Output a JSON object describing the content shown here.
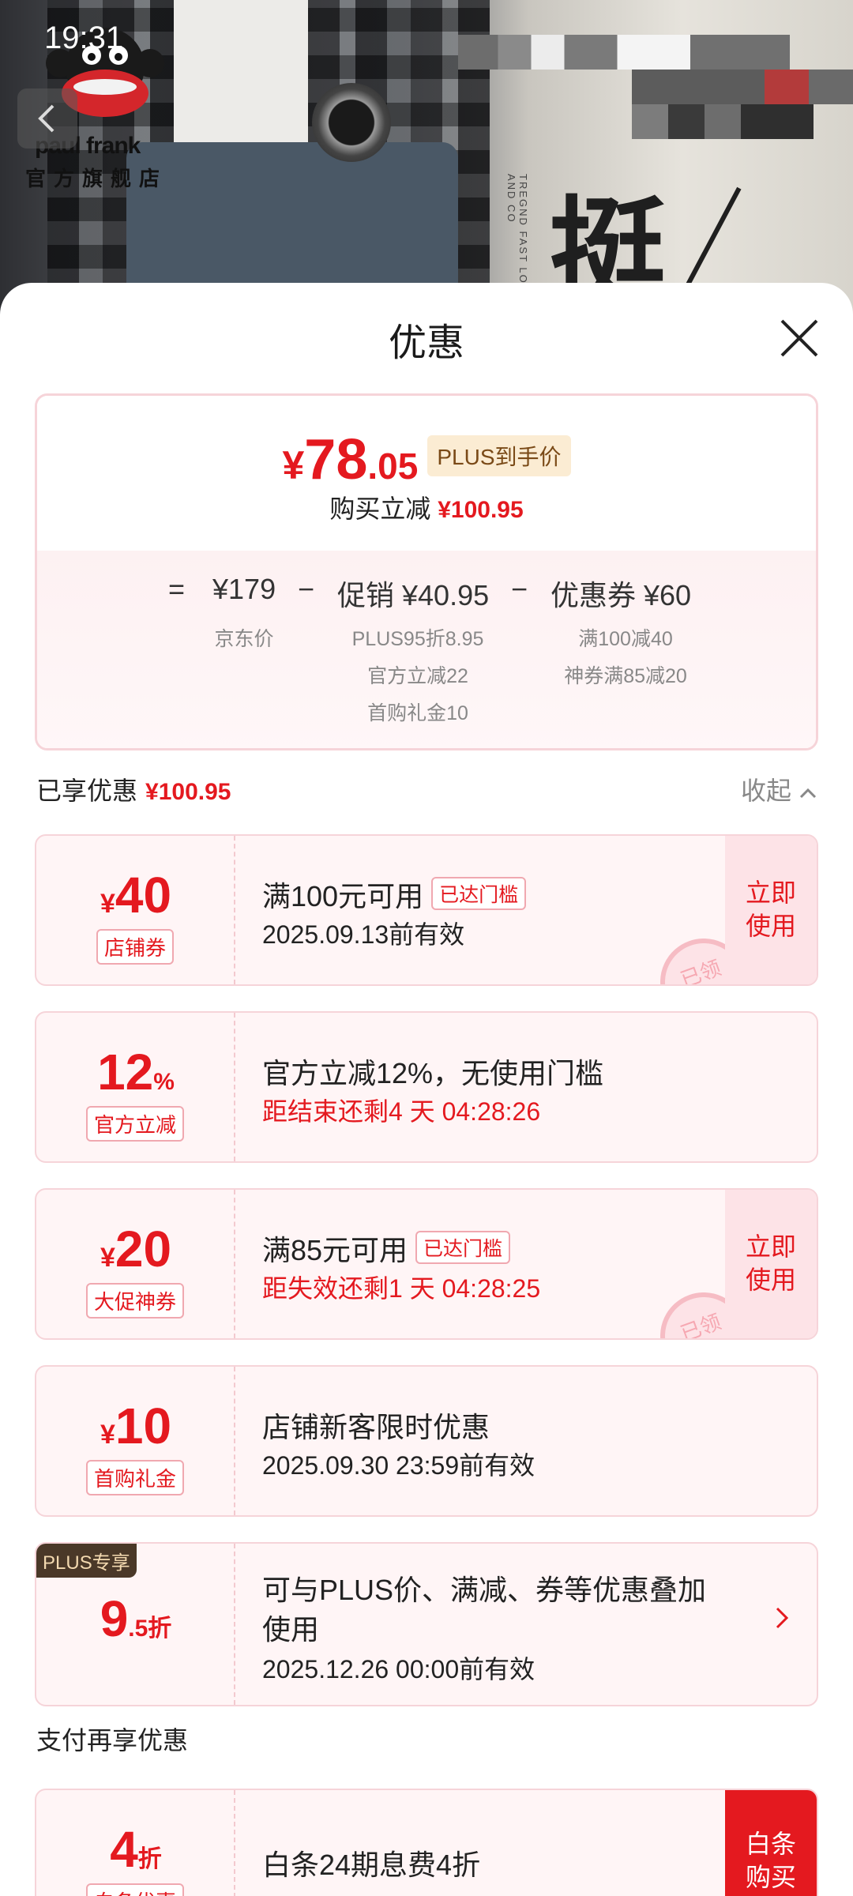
{
  "status_bar": {
    "time": "19:31"
  },
  "banner": {
    "brand_name": "paul frank",
    "brand_sub": "官方旗舰店",
    "big_char": "挺",
    "vertical_text": "TREGND FAST LOOSE AND CO"
  },
  "sheet": {
    "title": "优惠"
  },
  "summary": {
    "price_yen": "¥",
    "price_int": "78",
    "price_dec": ".05",
    "plus_tag": "PLUS到手价",
    "reduce_label": "购买立减",
    "reduce_amount": "¥100.95",
    "equals": "=",
    "base_price": "¥179",
    "base_label": "京东价",
    "minus1": "−",
    "promo": "促销 ¥40.95",
    "promo_details": [
      "PLUS95折8.95",
      "官方立减22",
      "首购礼金10"
    ],
    "minus2": "−",
    "coupon": "优惠券 ¥60",
    "coupon_details": [
      "满100减40",
      "神券满85减20"
    ]
  },
  "enjoyed": {
    "label": "已享优惠",
    "amount": "¥100.95",
    "collapse": "收起"
  },
  "cards": [
    {
      "yen": "¥",
      "amount": "40",
      "suffix": "",
      "tag": "店铺券",
      "line1": "满100元可用",
      "reached": "已达门槛",
      "line2": "2025.09.13前有效",
      "button": "立即使用",
      "stamp": "已领"
    },
    {
      "yen": "",
      "amount": "12",
      "suffix": "%",
      "tag": "官方立减",
      "line1": "官方立减12%，无使用门槛",
      "line2": "距结束还剩4 天 04:28:26"
    },
    {
      "yen": "¥",
      "amount": "20",
      "suffix": "",
      "tag": "大促神券",
      "line1": "满85元可用",
      "reached": "已达门槛",
      "line2": "距失效还剩1 天 04:28:25",
      "button": "立即使用",
      "stamp": "已领"
    },
    {
      "yen": "¥",
      "amount": "10",
      "suffix": "",
      "tag": "首购礼金",
      "line1": "店铺新客限时优惠",
      "line2": "2025.09.30 23:59前有效"
    },
    {
      "badge": "PLUS专享",
      "amount": "9",
      "suffix": ".5折",
      "line1": "可与PLUS价、满减、券等优惠叠加",
      "line1b": "使用",
      "line2": "2025.12.26 00:00前有效"
    }
  ],
  "pay": {
    "title": "支付再享优惠",
    "amount": "4",
    "suffix": "折",
    "tag": "白条优惠",
    "line1": "白条24期息费4折",
    "button": "白条购买"
  },
  "colors": {
    "accent": "#e4191f",
    "card_bg": "#fff5f6",
    "card_border": "#f6d4d9"
  }
}
